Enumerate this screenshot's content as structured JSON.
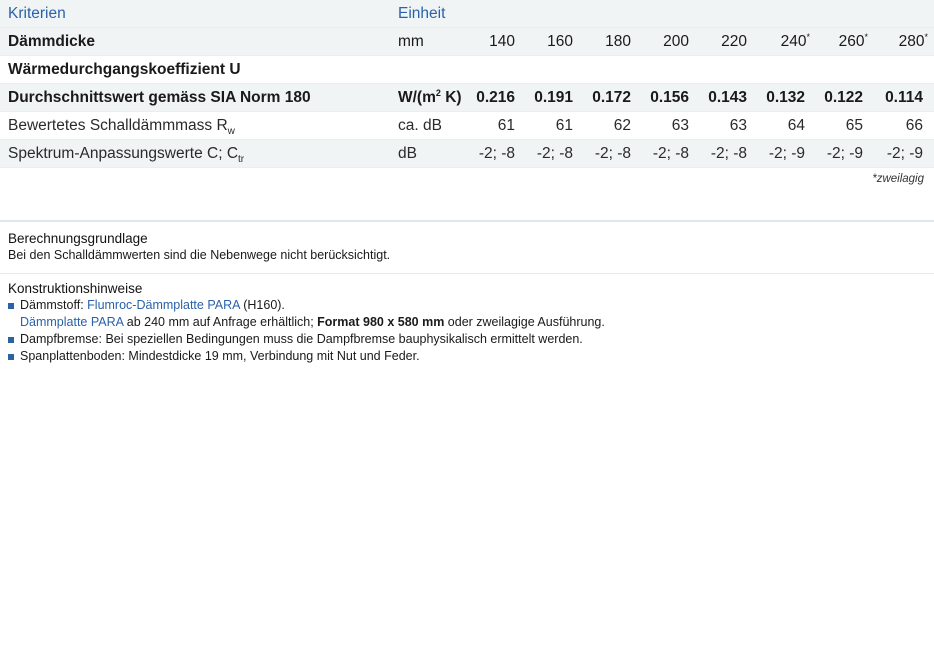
{
  "table": {
    "header": {
      "criteria": "Kriterien",
      "unit": "Einheit"
    },
    "thickness": {
      "label": "Dämmdicke",
      "unit": "mm",
      "values": [
        "140",
        "160",
        "180",
        "200",
        "220",
        "240",
        "260",
        "280"
      ],
      "marker": "*"
    },
    "u_title": "Wärmedurchgangskoeffizient U",
    "u_row": {
      "label": "Durchschnittswert gemäss SIA Norm 180",
      "unit_main": "W/(m",
      "unit_sup": "2",
      "unit_tail": " K)",
      "values": [
        "0.216",
        "0.191",
        "0.172",
        "0.156",
        "0.143",
        "0.132",
        "0.122",
        "0.114"
      ]
    },
    "sound_row": {
      "label_main": "Bewertetes Schalldämmmass R",
      "label_sub": "w",
      "unit": "ca. dB",
      "values": [
        "61",
        "61",
        "62",
        "63",
        "63",
        "64",
        "65",
        "66"
      ]
    },
    "spectrum_row": {
      "label_main": "Spektrum-Anpassungswerte C; C",
      "label_sub": "tr",
      "unit": "dB",
      "values": [
        "-2; -8",
        "-2; -8",
        "-2; -8",
        "-2; -8",
        "-2; -8",
        "-2; -9",
        "-2; -9",
        "-2; -9"
      ]
    },
    "footnote": "*zweilagig"
  },
  "basis": {
    "title": "Berechnungsgrundlage",
    "text": "Bei den Schalldämmwerten sind die Nebenwege nicht berücksichtigt."
  },
  "construction": {
    "title": "Konstruktionshinweise",
    "item1": {
      "prefix": "Dämmstoff: ",
      "product": "Flumroc-Dämmplatte PARA",
      "suffix": " (H160)."
    },
    "item1_cont": {
      "product": "Dämmplatte PARA",
      "middle": " ab 240 mm auf Anfrage erhältlich; ",
      "format": "Format 980 x 580 mm",
      "tail": " oder zweilagige Ausführung."
    },
    "item2": "Dampfbremse: Bei speziellen Bedingungen muss die Dampfbremse bauphysikalisch ermittelt werden.",
    "item3": "Spanplattenboden: Mindestdicke 19 mm, Verbindung mit Nut und Feder."
  },
  "colors": {
    "accent": "#2a62a9",
    "band": "#f0f4f5"
  }
}
